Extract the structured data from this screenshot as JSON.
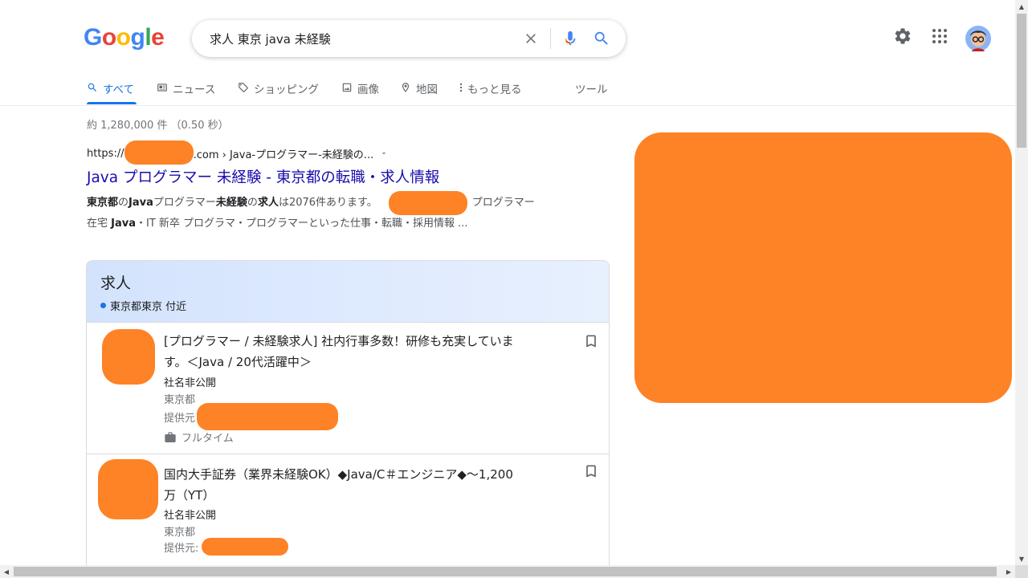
{
  "logo": {
    "letters": [
      "G",
      "o",
      "o",
      "g",
      "l",
      "e"
    ],
    "colors": [
      "#4285f4",
      "#ea4335",
      "#fbbc05",
      "#4285f4",
      "#34a853",
      "#ea4335"
    ]
  },
  "search": {
    "value": "求人 東京 java 未経験",
    "clear_icon": "close-icon",
    "mic_icon": "mic-icon",
    "search_icon": "search-icon"
  },
  "header": {
    "settings_icon": "gear-icon",
    "apps_icon": "apps-grid-icon",
    "avatar_icon": "avatar"
  },
  "tabs": [
    {
      "label": "すべて",
      "icon": "search-icon",
      "active": true
    },
    {
      "label": "ニュース",
      "icon": "news-icon"
    },
    {
      "label": "ショッピング",
      "icon": "tag-icon"
    },
    {
      "label": "画像",
      "icon": "image-icon"
    },
    {
      "label": "地図",
      "icon": "map-pin-icon"
    },
    {
      "label": "もっと見る",
      "icon": "more-vert-icon"
    }
  ],
  "tools_label": "ツール",
  "stats": "約 1,280,000 件 （0.50 秒）",
  "result1": {
    "cite_prefix": "https://",
    "cite_suffix": ".com › Java-プログラマー-未経験の...",
    "title": "Java プログラマー 未経験 - 東京都の転職・求人情報",
    "snippet_b1": "東京都",
    "snippet_t1": "の",
    "snippet_b2": "Java",
    "snippet_t2": " プログラマー ",
    "snippet_b3": "未経験",
    "snippet_t3": "の",
    "snippet_b4": "求人",
    "snippet_t4": "は2076件あります。",
    "snippet_t5": "プログラマー",
    "snippet_line2_t1": "在宅 ",
    "snippet_line2_b1": "Java",
    "snippet_line2_t2": "・IT 新卒 プログラマ・プログラマーといった仕事・転職・採用情報 ..."
  },
  "jobs": {
    "heading": "求人",
    "location": "東京都東京 付近",
    "items": [
      {
        "title": "[プログラマー / 未経験求人] 社内行事多数！研修も充実しています。＜Java / 20代活躍中＞",
        "company": "社名非公開",
        "location": "東京都",
        "via": "提供元",
        "type": "フルタイム"
      },
      {
        "title": "国内大手証券（業界未経験OK）◆Java/C＃エンジニア◆〜1,200万（YT）",
        "company": "社名非公開",
        "location": "東京都",
        "via": "提供元:"
      }
    ]
  },
  "redact_color": "#fe8226"
}
